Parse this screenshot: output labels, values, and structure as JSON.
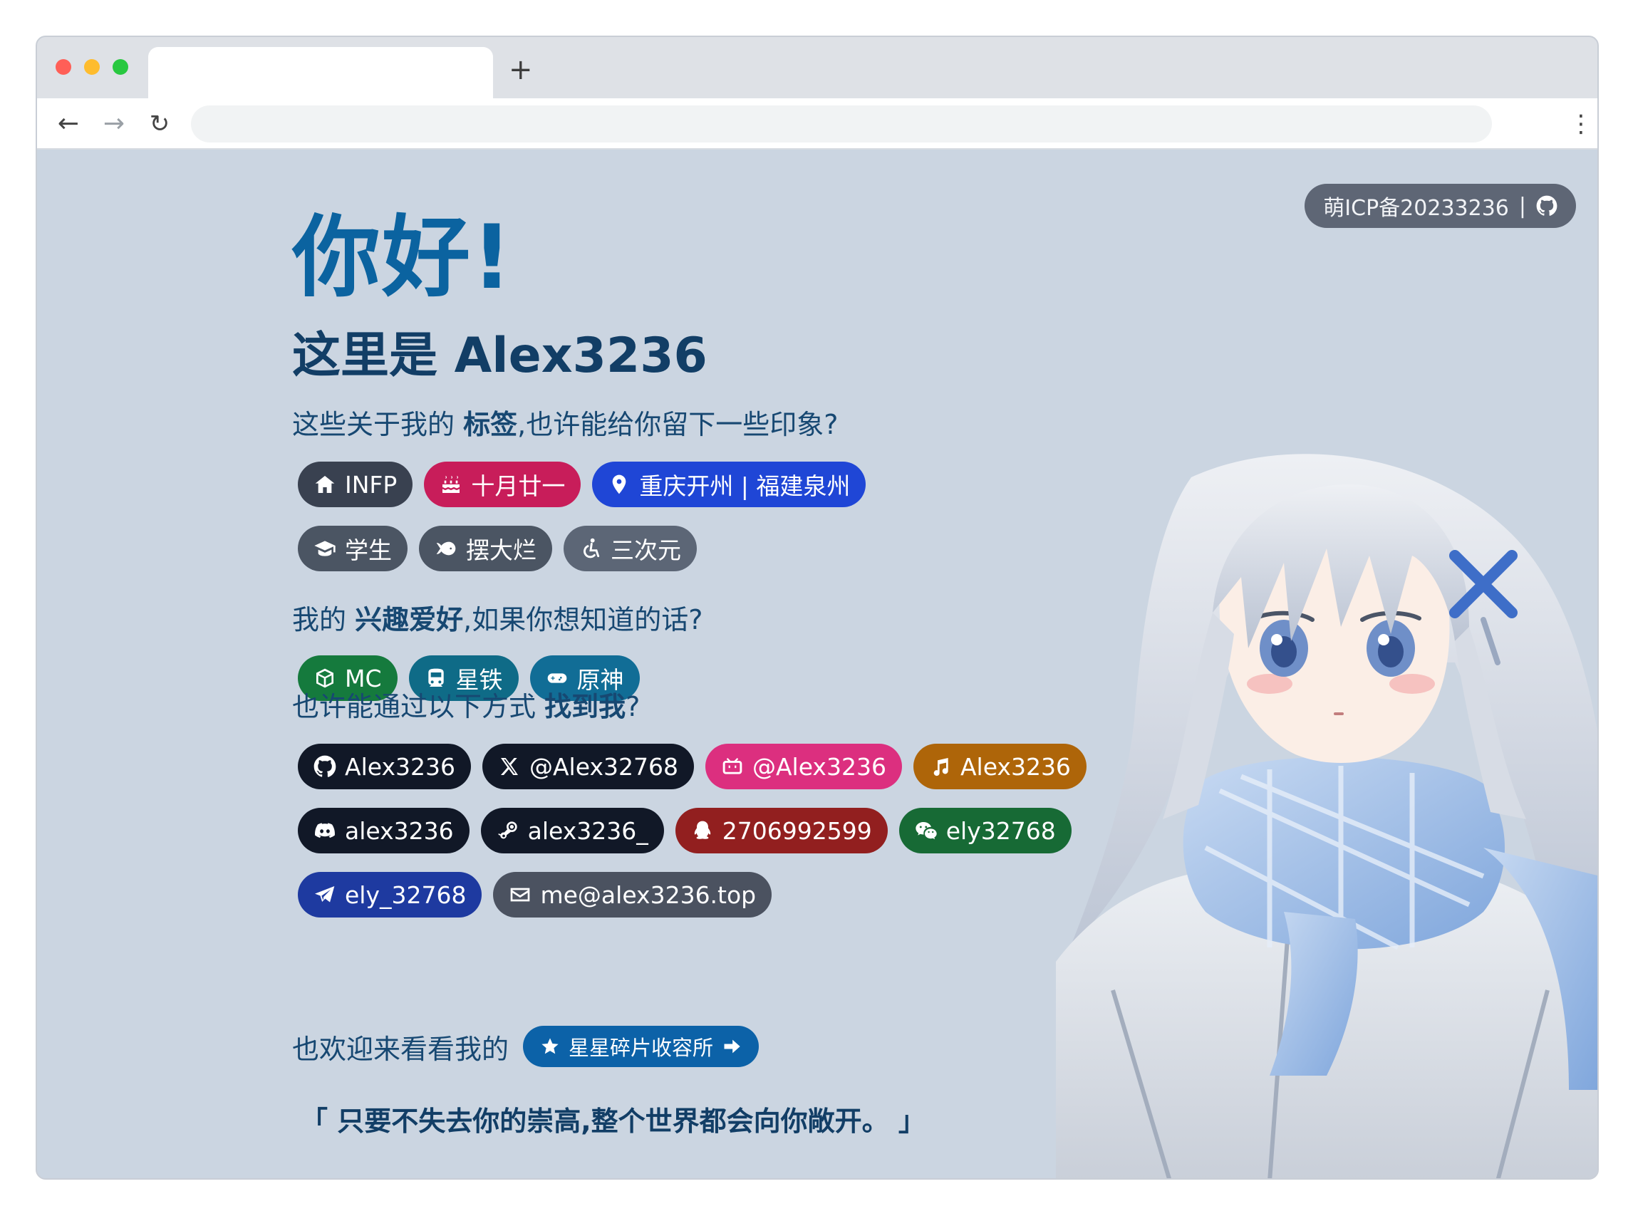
{
  "browser": {
    "tab_title": "",
    "new_tab": "+",
    "back": "←",
    "forward": "→",
    "reload": "↻",
    "address": "",
    "menu": "⋮"
  },
  "icp": {
    "text": "萌ICP备20233236",
    "separator": "|",
    "icon": "github-icon"
  },
  "hero": {
    "greeting": "你好!",
    "intro": "这里是 Alex3236"
  },
  "tags_section": {
    "prefix": "这些关于我的 ",
    "strong": "标签",
    "suffix": ",也许能给你留下一些印象?"
  },
  "tags": [
    {
      "label": "INFP",
      "icon": "house-icon",
      "color": "#394150"
    },
    {
      "label": "十月廿一",
      "icon": "cake-icon",
      "color": "#c81d5a"
    },
    {
      "label": "重庆开州 | 福建泉州",
      "icon": "location-pin-icon",
      "color": "#1f46d6"
    },
    {
      "label": "学生",
      "icon": "graduation-cap-icon",
      "color": "#4b5563"
    },
    {
      "label": "摆大烂",
      "icon": "fish-icon",
      "color": "#4b5563"
    },
    {
      "label": "三次元",
      "icon": "accessibility-icon",
      "color": "#5c6676"
    }
  ],
  "hobbies_section": {
    "prefix": "我的 ",
    "strong": "兴趣爱好",
    "suffix": ",如果你想知道的话?"
  },
  "hobbies": [
    {
      "label": "MC",
      "icon": "cube-icon",
      "color": "#157a3d"
    },
    {
      "label": "星铁",
      "icon": "train-icon",
      "color": "#0f6b87"
    },
    {
      "label": "原神",
      "icon": "gamepad-icon",
      "color": "#116d96"
    }
  ],
  "contact_section": {
    "prefix": "也许能通过以下方式 ",
    "strong": "找到我",
    "suffix": "?"
  },
  "contacts": [
    {
      "label": "Alex3236",
      "icon": "github-icon",
      "color": "#111827"
    },
    {
      "label": "@Alex32768",
      "icon": "x-twitter-icon",
      "color": "#111827"
    },
    {
      "label": "@Alex3236",
      "icon": "bilibili-icon",
      "color": "#dc2f7f"
    },
    {
      "label": "Alex3236",
      "icon": "music-note-icon",
      "color": "#ae6509"
    },
    {
      "label": "alex3236",
      "icon": "discord-icon",
      "color": "#111827"
    },
    {
      "label": "alex3236_",
      "icon": "steam-icon",
      "color": "#111827"
    },
    {
      "label": "2706992599",
      "icon": "qq-icon",
      "color": "#921f1f"
    },
    {
      "label": "ely32768",
      "icon": "wechat-icon",
      "color": "#176a35"
    },
    {
      "label": "ely_32768",
      "icon": "telegram-icon",
      "color": "#1e3aa0"
    },
    {
      "label": "me@alex3236.top",
      "icon": "envelope-icon",
      "color": "#4b5260"
    }
  ],
  "visit": {
    "text": "也欢迎来看看我的",
    "button": "星星碎片收容所",
    "icon": "star-icon",
    "arrow_icon": "arrow-right-icon"
  },
  "quote": "「 只要不失去你的崇高,整个世界都会向你敞开。 」",
  "avatar": {
    "description_icon": "anime-girl-illustration"
  }
}
